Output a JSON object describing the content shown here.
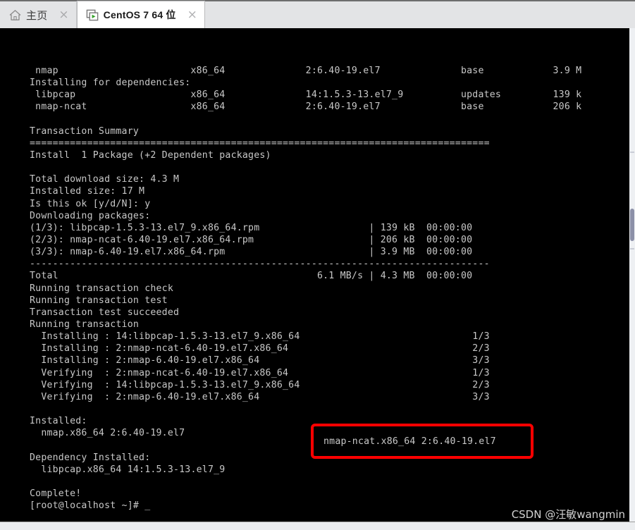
{
  "window": {
    "tabs": [
      {
        "label": "主页",
        "icon": "home-icon",
        "active": false,
        "close": "×"
      },
      {
        "label": "CentOS 7 64 位",
        "icon": "virtual-machine-icon",
        "active": true,
        "close": "×"
      }
    ]
  },
  "colors": {
    "terminal_background": "#000000",
    "terminal_text": "#c8c8c8",
    "highlight_border": "#ff0000",
    "tabbar_background": "#e3e4e6",
    "active_tab_background": "#ffffff"
  },
  "terminal": {
    "lines": [
      " nmap                       x86_64              2:6.40-19.el7              base            3.9 M",
      "Installing for dependencies:",
      " libpcap                    x86_64              14:1.5.3-13.el7_9          updates         139 k",
      " nmap-ncat                  x86_64              2:6.40-19.el7              base            206 k",
      "",
      "Transaction Summary",
      "================================================================================",
      "Install  1 Package (+2 Dependent packages)",
      "",
      "Total download size: 4.3 M",
      "Installed size: 17 M",
      "Is this ok [y/d/N]: y",
      "Downloading packages:",
      "(1/3): libpcap-1.5.3-13.el7_9.x86_64.rpm                   | 139 kB  00:00:00",
      "(2/3): nmap-ncat-6.40-19.el7.x86_64.rpm                    | 206 kB  00:00:00",
      "(3/3): nmap-6.40-19.el7.x86_64.rpm                         | 3.9 MB  00:00:00",
      "--------------------------------------------------------------------------------",
      "Total                                             6.1 MB/s | 4.3 MB  00:00:00",
      "Running transaction check",
      "Running transaction test",
      "Transaction test succeeded",
      "Running transaction",
      "  Installing : 14:libpcap-1.5.3-13.el7_9.x86_64                              1/3",
      "  Installing : 2:nmap-ncat-6.40-19.el7.x86_64                                2/3",
      "  Installing : 2:nmap-6.40-19.el7.x86_64                                     3/3",
      "  Verifying  : 2:nmap-ncat-6.40-19.el7.x86_64                                1/3",
      "  Verifying  : 14:libpcap-1.5.3-13.el7_9.x86_64                              2/3",
      "  Verifying  : 2:nmap-6.40-19.el7.x86_64                                     3/3",
      "",
      "Installed:",
      "  nmap.x86_64 2:6.40-19.el7",
      "",
      "Dependency Installed:",
      "  libpcap.x86_64 14:1.5.3-13.el7_9",
      "",
      "Complete!",
      "[root@localhost ~]# _"
    ]
  },
  "highlight": {
    "text": "nmap-ncat.x86_64 2:6.40-19.el7"
  },
  "watermark": {
    "text": "CSDN @汪敏wangmin"
  }
}
